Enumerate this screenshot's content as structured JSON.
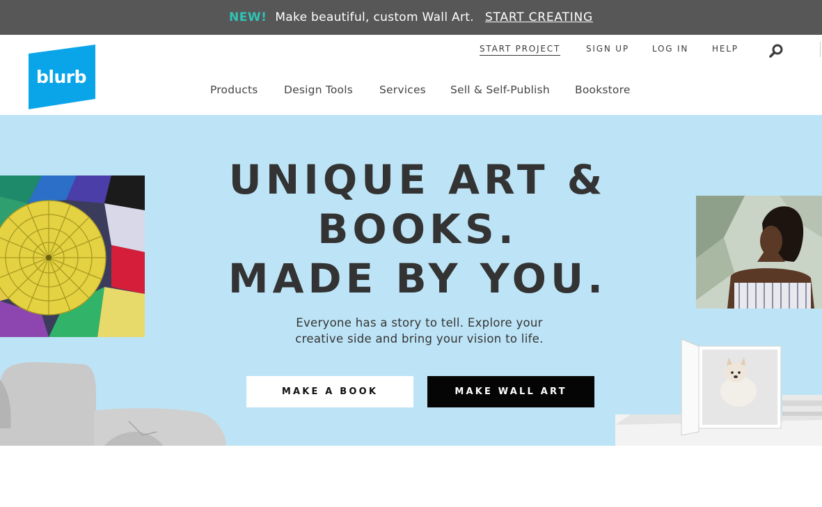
{
  "promo": {
    "badge": "NEW!",
    "message": "Make beautiful, custom Wall Art.",
    "cta": "START CREATING"
  },
  "header": {
    "logo_text": "blurb",
    "utility_nav": [
      "START PROJECT",
      "SIGN UP",
      "LOG IN",
      "HELP"
    ],
    "main_nav": [
      "Products",
      "Design Tools",
      "Services",
      "Sell & Self-Publish",
      "Bookstore"
    ]
  },
  "hero": {
    "headline": [
      "UNIQUE ART &",
      "BOOKS.",
      "MADE BY YOU."
    ],
    "subtext": [
      "Everyone has a story to tell. Explore your",
      "creative side and bring your vision to life."
    ],
    "buttons": {
      "book": "MAKE A BOOK",
      "wall_art": "MAKE WALL ART"
    }
  },
  "colors": {
    "promo_bg": "#575757",
    "promo_accent": "#2ec4b6",
    "brand_blue": "#0aa5e9",
    "hero_bg": "#bde4f6",
    "primary_button": "#050505"
  },
  "icons": [
    "search-icon"
  ]
}
